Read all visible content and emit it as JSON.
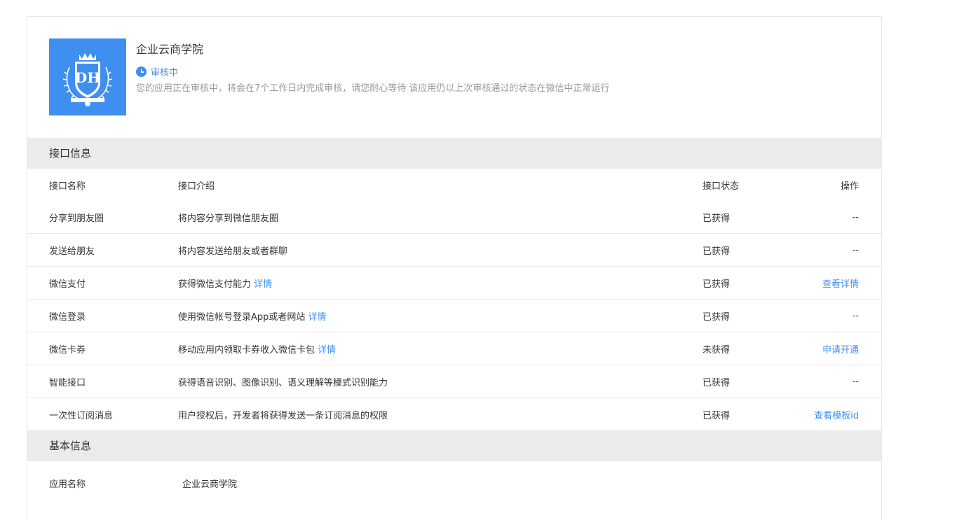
{
  "app": {
    "name": "企业云商学院",
    "status_label": "审核中",
    "status_desc": "您的应用正在审核中，将会在7个工作日内完成审核，请您耐心等待 该应用仍以上次审核通过的状态在微信中正常运行",
    "logo_icon": "crown-shield-logo",
    "logo_monogram": "DH",
    "accent_color": "#3f8ff0"
  },
  "api_section": {
    "title": "接口信息",
    "columns": [
      "接口名称",
      "接口介绍",
      "接口状态",
      "操作"
    ],
    "rows": [
      {
        "name": "分享到朋友圈",
        "desc": "将内容分享到微信朋友圈",
        "detail": "",
        "status": "已获得",
        "action": "--",
        "action_link": false
      },
      {
        "name": "发送给朋友",
        "desc": "将内容发送给朋友或者群聊",
        "detail": "",
        "status": "已获得",
        "action": "--",
        "action_link": false
      },
      {
        "name": "微信支付",
        "desc": "获得微信支付能力",
        "detail": "详情",
        "status": "已获得",
        "action": "查看详情",
        "action_link": true
      },
      {
        "name": "微信登录",
        "desc": "使用微信帐号登录App或者网站",
        "detail": "详情",
        "status": "已获得",
        "action": "--",
        "action_link": false
      },
      {
        "name": "微信卡券",
        "desc": "移动应用内领取卡券收入微信卡包",
        "detail": "详情",
        "status": "未获得",
        "action": "申请开通",
        "action_link": true
      },
      {
        "name": "智能接口",
        "desc": "获得语音识别、图像识别、语义理解等模式识别能力",
        "detail": "",
        "status": "已获得",
        "action": "--",
        "action_link": false
      },
      {
        "name": "一次性订阅消息",
        "desc": "用户授权后，开发者将获得发送一条订阅消息的权限",
        "detail": "",
        "status": "已获得",
        "action": "查看模板id",
        "action_link": true
      }
    ]
  },
  "basic_section": {
    "title": "基本信息",
    "rows": [
      {
        "label": "应用名称",
        "value": "企业云商学院"
      }
    ]
  }
}
